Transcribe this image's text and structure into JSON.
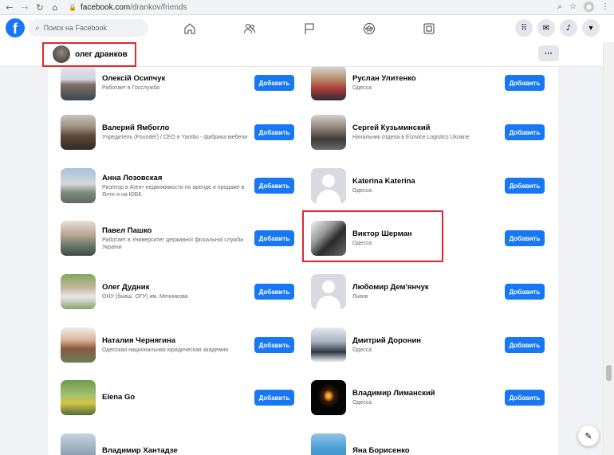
{
  "browser": {
    "url_host": "facebook.com",
    "url_path": "/drankov/friends"
  },
  "header": {
    "logo": "f",
    "search_placeholder": "Поиск на Facebook",
    "tabs": [
      "home-icon",
      "friends-icon",
      "flag-icon",
      "groups-icon",
      "gaming-icon"
    ]
  },
  "profile": {
    "name": "олег дранков",
    "more_label": "···"
  },
  "add_label": "Добавить",
  "friends_left": [
    {
      "name": "Олексій Осипчук",
      "sub": "Работает в Госслужба"
    },
    {
      "name": "Валерий Ямбогло",
      "sub": "Учредитель (Founder) / CEO в Yambo - фабрика мебели"
    },
    {
      "name": "Анна Лозовская",
      "sub": "Риэлтор в Агент недвижимости по аренде и продаже в Ялте и на ЮБК"
    },
    {
      "name": "Павел Пашко",
      "sub": "Работает в Университет державної фіскальної служби України"
    },
    {
      "name": "Олег Дудник",
      "sub": "ОНУ (бывш. ОГУ) им. Мечникова"
    },
    {
      "name": "Наталия Чернягина",
      "sub": "Одесская национальная юридическая академия"
    },
    {
      "name": "Elena Go",
      "sub": ""
    },
    {
      "name": "Владимир Хантадзе",
      "sub": ""
    }
  ],
  "friends_right": [
    {
      "name": "Руслан Улитенко",
      "sub": "Одесса"
    },
    {
      "name": "Сергей Кузьминский",
      "sub": "Начальник отдела в Ecovice Logistics Ukraine"
    },
    {
      "name": "Katerina Katerina",
      "sub": "Одесса"
    },
    {
      "name": "Виктор Шерман",
      "sub": "Одесса"
    },
    {
      "name": "Любомир Дем'янчук",
      "sub": "Львов"
    },
    {
      "name": "Дмитрий Доронин",
      "sub": "Одесса"
    },
    {
      "name": "Владимир Лиманский",
      "sub": "Одесса"
    },
    {
      "name": "Яна Борисенко",
      "sub": ""
    }
  ],
  "colors": {
    "accent": "#1877f2",
    "highlight": "#e0262a",
    "page_bg": "#f0f2f5"
  }
}
